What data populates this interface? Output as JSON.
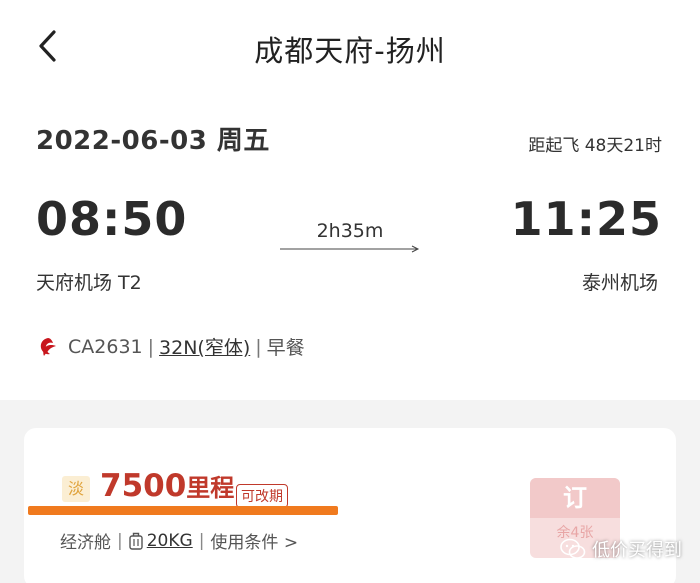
{
  "header": {
    "title": "成都天府-扬州",
    "back_icon": "chevron-left-icon"
  },
  "flight": {
    "date": "2022-06-03 周五",
    "countdown": "距起飞 48天21时",
    "departure_time": "08:50",
    "arrival_time": "11:25",
    "duration": "2h35m",
    "departure_airport": "天府机场 T2",
    "arrival_airport": "泰州机场",
    "airline_icon": "air-china-logo",
    "flight_no": "CA2631",
    "aircraft": "32N(窄体)",
    "meal": "早餐",
    "separator": "|"
  },
  "offer": {
    "season_badge": "淡",
    "price_value": "7500",
    "price_unit": "里程",
    "change_tag": "可改期",
    "cabin": "经济舱",
    "luggage_icon": "luggage-icon",
    "luggage": "20KG",
    "rules": "使用条件 >",
    "book_label": "订",
    "remaining": "余4张",
    "highlight_color": "#f07a1e",
    "price_color": "#c0392b"
  },
  "watermark": {
    "icon": "wechat-icon",
    "text": "低价买得到"
  }
}
